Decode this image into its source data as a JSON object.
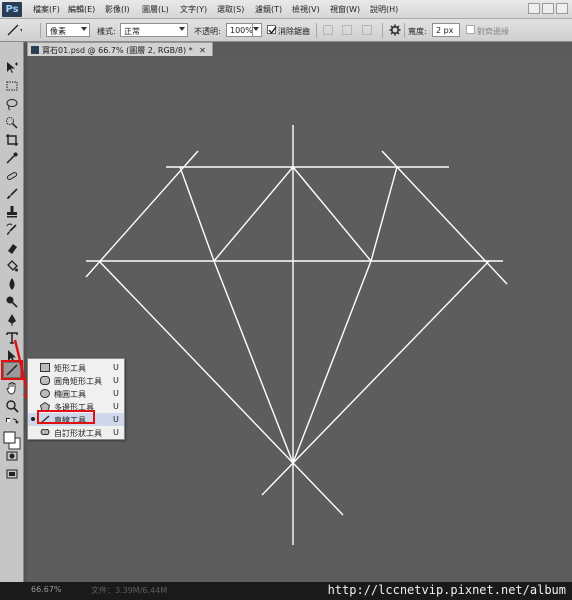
{
  "menubar": {
    "logo": "Ps",
    "items": [
      "檔案(F)",
      "編輯(E)",
      "影像(I)",
      "圖層(L)",
      "文字(Y)",
      "選取(S)",
      "濾鏡(T)",
      "檢視(V)",
      "視窗(W)",
      "說明(H)"
    ]
  },
  "options": {
    "mode_value": "像素",
    "style_label": "樣式:",
    "style_value": "正常",
    "opacity_label": "不透明:",
    "opacity_value": "100%",
    "antialias_label": "消除鋸齒",
    "width_label": "寬度:",
    "width_value": "2 px",
    "align_edges_label": "對齊邊緣"
  },
  "document": {
    "tab_title": "寶石01.psd @ 66.7% (圖層 2, RGB/8) *"
  },
  "flyout": {
    "items": [
      {
        "label": "矩形工具",
        "key": "U",
        "icon": "rectangle-icon"
      },
      {
        "label": "圓角矩形工具",
        "key": "U",
        "icon": "rounded-rectangle-icon"
      },
      {
        "label": "橢圓工具",
        "key": "U",
        "icon": "ellipse-icon"
      },
      {
        "label": "多邊形工具",
        "key": "U",
        "icon": "polygon-icon"
      },
      {
        "label": "直線工具",
        "key": "U",
        "icon": "line-icon"
      },
      {
        "label": "自訂形狀工具",
        "key": "U",
        "icon": "custom-shape-icon"
      }
    ],
    "selected_index": 4
  },
  "status": {
    "zoom": "66.67%",
    "doc_size": "文件：3.39M/6.44M"
  },
  "watermark": "http://lccnetvip.pixnet.net/album",
  "colors": {
    "highlight": "#e01010",
    "canvas": "#5d5d5d",
    "stroke": "#ffffff"
  }
}
